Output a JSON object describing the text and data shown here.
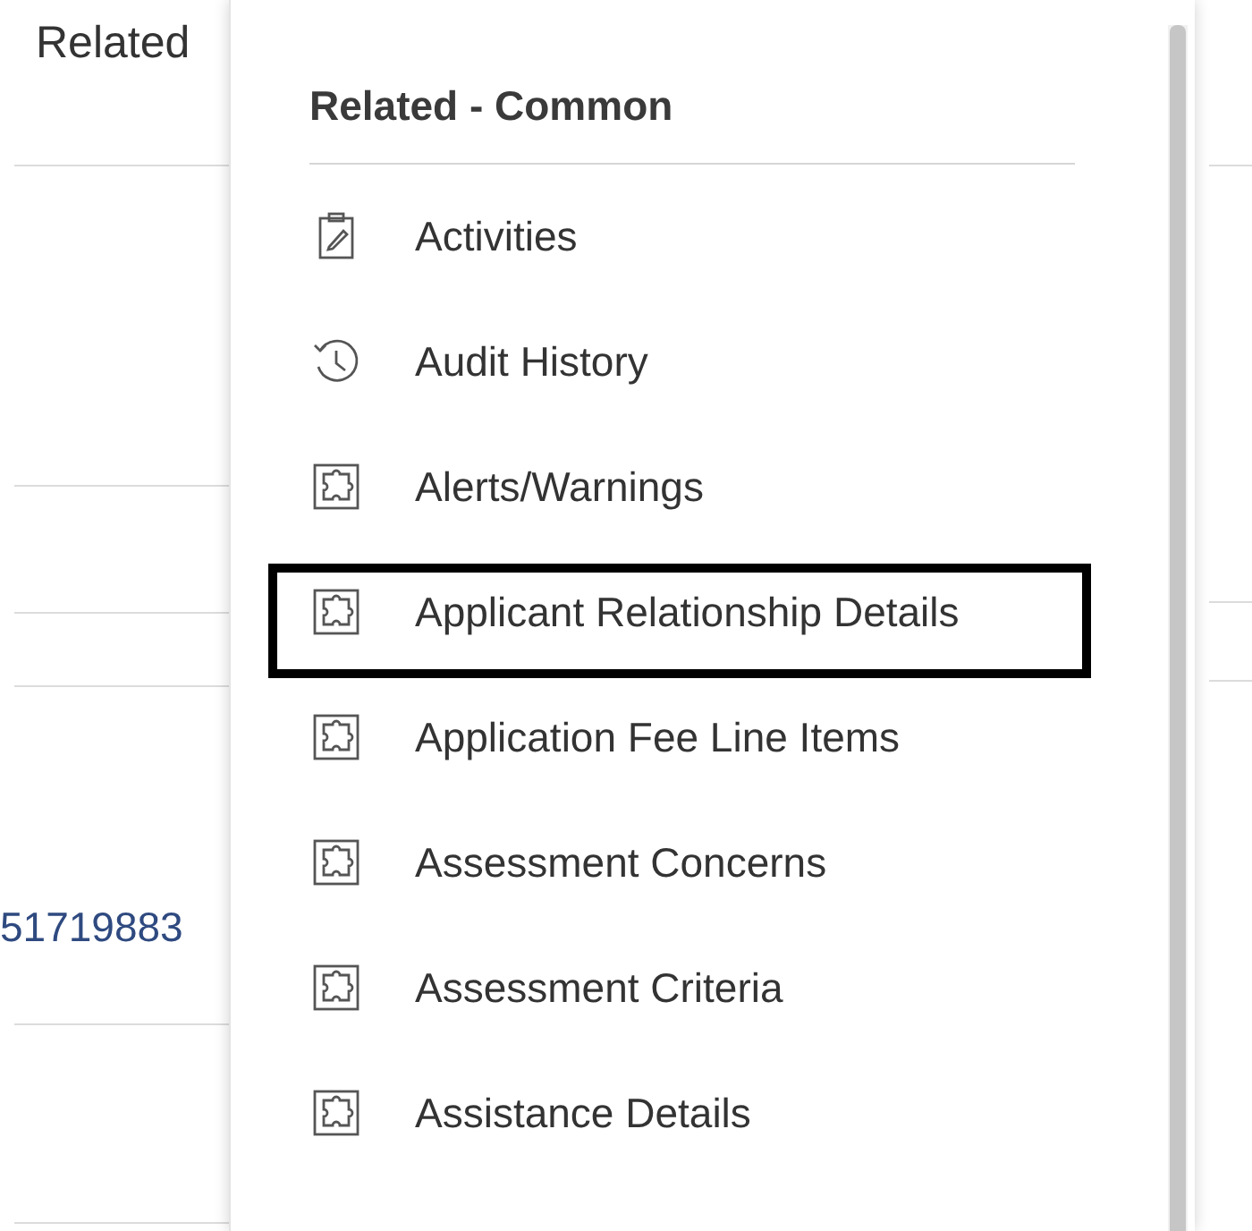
{
  "background": {
    "tab_label": "Related",
    "link": "51719883"
  },
  "menu": {
    "heading": "Related - Common",
    "items": [
      {
        "label": "Activities",
        "kind": "activity",
        "annotated": false
      },
      {
        "label": "Audit History",
        "kind": "history",
        "annotated": false
      },
      {
        "label": "Alerts/Warnings",
        "kind": "entity",
        "annotated": false
      },
      {
        "label": "Applicant Relationship Details",
        "kind": "entity",
        "annotated": true
      },
      {
        "label": "Application Fee Line Items",
        "kind": "entity",
        "annotated": false
      },
      {
        "label": "Assessment Concerns",
        "kind": "entity",
        "annotated": false
      },
      {
        "label": "Assessment Criteria",
        "kind": "entity",
        "annotated": false
      },
      {
        "label": "Assistance Details",
        "kind": "entity",
        "annotated": false
      }
    ]
  }
}
